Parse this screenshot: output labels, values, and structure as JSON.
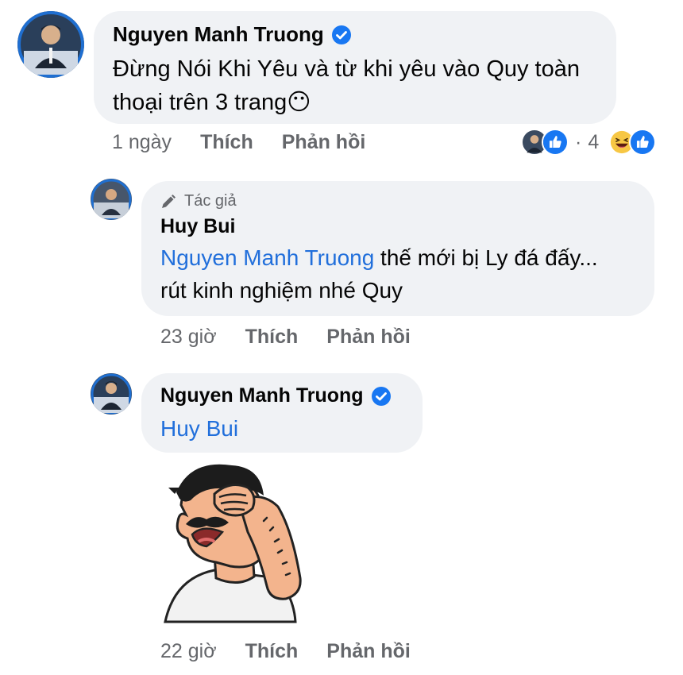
{
  "comments": [
    {
      "author": "Nguyen Manh Truong",
      "verified": true,
      "text": "Đừng Nói Khi Yêu và từ khi yêu vào Quy toàn thoại trên 3 trang",
      "text_line1": "Đừng Nói Khi Yêu và từ khi yêu vào Quy toàn",
      "text_line2": "thoại trên 3 trang",
      "emoji": "😶",
      "time": "1 ngày",
      "like_label": "Thích",
      "reply_label": "Phản hồi",
      "reactions": {
        "separator": "·",
        "count": "4"
      }
    },
    {
      "author_tag": "Tác giả",
      "author": "Huy Bui",
      "mention": "Nguyen Manh Truong",
      "text_line1": " thế mới bị Ly đá đấy...",
      "text_line2": "rút kinh nghiệm nhé Quy",
      "time": "23 giờ",
      "like_label": "Thích",
      "reply_label": "Phản hồi"
    },
    {
      "author": "Nguyen Manh Truong",
      "verified": true,
      "mention": "Huy Bui",
      "sticker": "facepalm-sticker",
      "time": "22 giờ",
      "like_label": "Thích",
      "reply_label": "Phản hồi"
    }
  ],
  "colors": {
    "bubble": "#f0f2f5",
    "mention": "#216fdb",
    "meta": "#65676b",
    "verified": "#1877f2"
  }
}
